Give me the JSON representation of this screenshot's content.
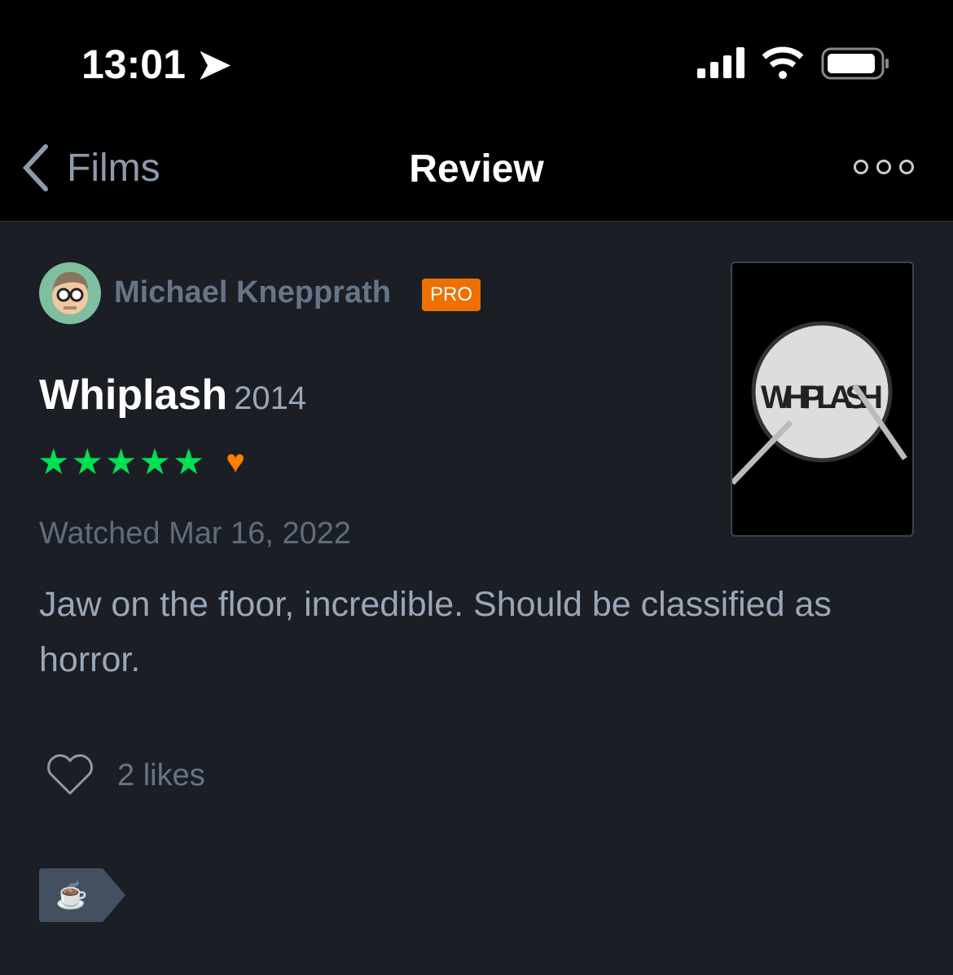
{
  "status_bar": {
    "time": "13:01"
  },
  "nav": {
    "back_label": "Films",
    "title": "Review"
  },
  "review": {
    "author": "Michael Knepprath",
    "badge": "PRO",
    "film_title": "Whiplash",
    "year": "2014",
    "rating_stars": 5,
    "liked": true,
    "watched": "Watched Mar 16, 2022",
    "text": "Jaw on the floor, incredible. Should be classified as horror.",
    "likes": "2 likes",
    "poster_title": "WHIPLASH",
    "tag_emoji": "☕"
  },
  "colors": {
    "accent_green": "#00e054",
    "accent_orange": "#ff8000",
    "pro": "#ee7000"
  }
}
